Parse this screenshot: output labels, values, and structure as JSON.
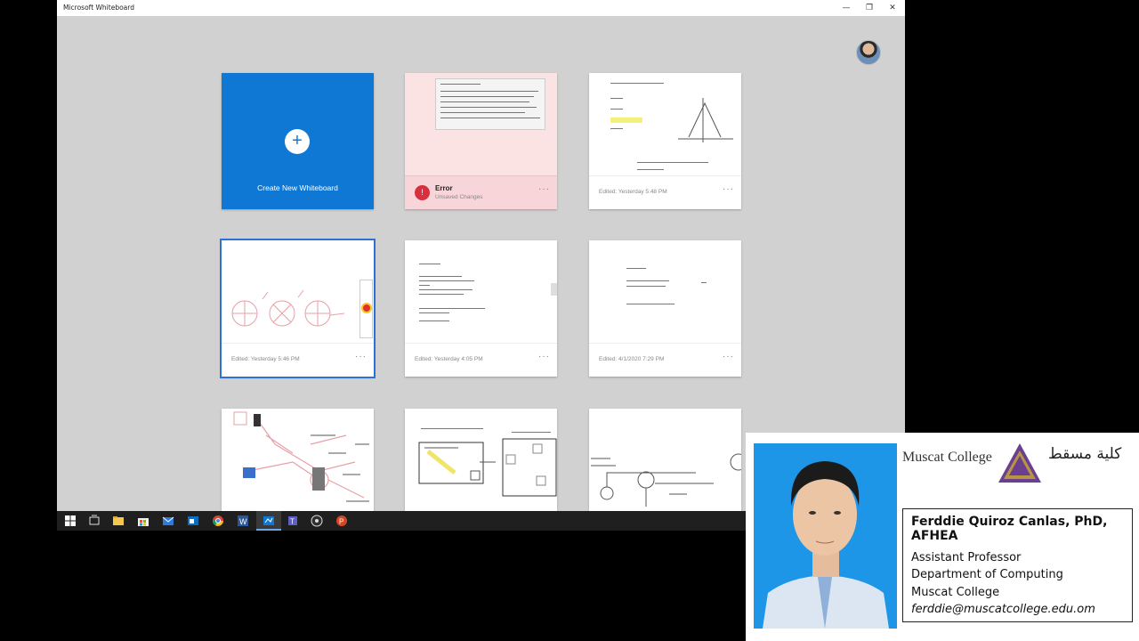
{
  "window": {
    "title": "Microsoft Whiteboard",
    "controls": {
      "minimize": "—",
      "restore": "❐",
      "close": "✕"
    }
  },
  "create_card": {
    "label": "Create New Whiteboard",
    "plus": "+"
  },
  "error_card": {
    "title": "Error",
    "subtitle": "Unsaved Changes"
  },
  "boards": [
    {
      "edited": "Edited: Yesterday 5:48 PM"
    },
    {
      "edited": "Edited: Yesterday 5:46 PM"
    },
    {
      "edited": "Edited: Yesterday 4:05 PM"
    },
    {
      "edited": "Edited: 4/1/2020 7:29 PM"
    }
  ],
  "more_label": "···",
  "taskbar_icons": [
    "windows-start-icon",
    "task-view-icon",
    "file-explorer-icon",
    "store-icon",
    "mail-icon",
    "outlook-icon",
    "chrome-icon",
    "word-icon",
    "whiteboard-icon",
    "teams-icon",
    "obs-icon",
    "powerpoint-icon"
  ],
  "presenter": {
    "college": "Muscat College",
    "college_arabic": "كلية مسقط",
    "name": "Ferddie Quiroz Canlas, PhD, AFHEA",
    "title": "Assistant Professor",
    "department": "Department of Computing",
    "institution": "Muscat College",
    "email": "ferddie@muscatcollege.edu.om"
  },
  "colors": {
    "accent": "#0f78d4",
    "error": "#d9303f",
    "photo_bg": "#1e96e8"
  }
}
